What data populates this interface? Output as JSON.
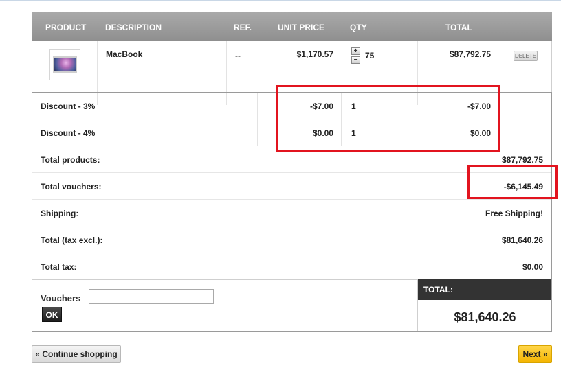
{
  "cart": {
    "headers": {
      "product": "PRODUCT",
      "description": "DESCRIPTION",
      "ref": "REF.",
      "unit_price": "UNIT PRICE",
      "qty": "QTY",
      "total": "TOTAL"
    },
    "product": {
      "name": "MacBook",
      "ref": "--",
      "unit_price": "$1,170.57",
      "qty_plus": "+",
      "qty_minus": "−",
      "qty": "75",
      "total": "$87,792.75",
      "delete_label": "DELETE"
    },
    "discounts": [
      {
        "label": "Discount - 3%",
        "unit_price": "-$7.00",
        "qty": "1",
        "total": "-$7.00"
      },
      {
        "label": "Discount - 4%",
        "unit_price": "$0.00",
        "qty": "1",
        "total": "$0.00"
      }
    ],
    "totals": [
      {
        "label": "Total products:",
        "value": "$87,792.75"
      },
      {
        "label": "Total vouchers:",
        "value": "-$6,145.49"
      },
      {
        "label": "Shipping:",
        "value": "Free Shipping!"
      },
      {
        "label": "Total (tax excl.):",
        "value": "$81,640.26"
      },
      {
        "label": "Total tax:",
        "value": "$0.00"
      }
    ],
    "vouchers": {
      "label": "Vouchers",
      "input_value": "",
      "ok_label": "OK"
    },
    "grand_total": {
      "label": "TOTAL:",
      "value": "$81,640.26"
    }
  },
  "nav": {
    "continue_label": "« Continue shopping",
    "next_label": "Next »"
  },
  "colors": {
    "header_bg": "#999999",
    "highlight": "#e2141f",
    "next_button": "#f4b400",
    "grand_total_bg": "#333333"
  }
}
